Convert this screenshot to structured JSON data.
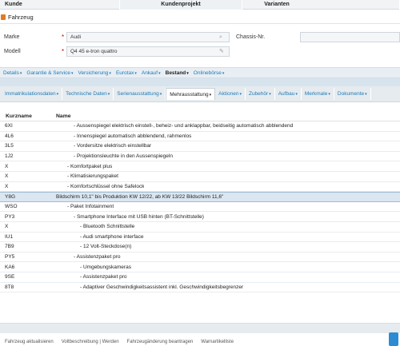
{
  "top_tabs": [
    "Kunde",
    "Kundenprojekt",
    "Varianten"
  ],
  "panel": {
    "title": "Fahrzeug"
  },
  "form": {
    "marke_label": "Marke",
    "marke_value": "Audi",
    "modell_label": "Modell",
    "modell_value": "Q4 45 e-tron quattro",
    "chassis_label": "Chassis-Nr.",
    "required_mark": "*"
  },
  "nav1": [
    {
      "label": "Details",
      "active": false
    },
    {
      "label": "Garantie & Service",
      "active": false
    },
    {
      "label": "Versicherung",
      "active": false
    },
    {
      "label": "Eurotax",
      "active": false
    },
    {
      "label": "Ankauf",
      "active": false
    },
    {
      "label": "Bestand",
      "active": true
    },
    {
      "label": "Onlinebörse",
      "active": false
    }
  ],
  "nav2": [
    {
      "label": "Immatrikulationsdaten",
      "active": false
    },
    {
      "label": "Technische Daten",
      "active": false
    },
    {
      "label": "Serienausstattung",
      "active": false
    },
    {
      "label": "Mehrausstattung",
      "active": true
    },
    {
      "label": "Aktionen",
      "active": false
    },
    {
      "label": "Zubehör",
      "active": false
    },
    {
      "label": "Aufbau",
      "active": false
    },
    {
      "label": "Merkmale",
      "active": false
    },
    {
      "label": "Dokumente",
      "active": false
    }
  ],
  "grid": {
    "headers": [
      "Kurzname",
      "Name"
    ],
    "rows": [
      {
        "code": "6XI",
        "name": "- Aussenspiegel elektrisch einstell-, beheiz- und anklappbar, beidseitig automatisch abblendend",
        "indent": 1,
        "selected": false
      },
      {
        "code": "4L6",
        "name": "- Innenspiegel automatisch abblendend, rahmenlos",
        "indent": 1,
        "selected": false
      },
      {
        "code": "3L5",
        "name": "- Vordersitze elektrisch einstellbar",
        "indent": 1,
        "selected": false
      },
      {
        "code": "1J2",
        "name": "- Projektionsleuchte in den Aussenspiegeln",
        "indent": 1,
        "selected": false
      },
      {
        "code": "X",
        "name": "- Komfortpaket plus",
        "indent": 0,
        "selected": false
      },
      {
        "code": "X",
        "name": "- Klimatisierungspaket",
        "indent": 0,
        "selected": false
      },
      {
        "code": "X",
        "name": "- Komfortschlüssel ohne Safelock",
        "indent": 0,
        "selected": false
      },
      {
        "code": "Y8G",
        "name": "Bildschirm 10,1\" bis Produktion KW 12/22, ab KW 13/22 Bildschirm 11,6\"",
        "indent": -1,
        "selected": true
      },
      {
        "code": "WSO",
        "name": "- Paket Infotainment",
        "indent": 0,
        "selected": false
      },
      {
        "code": "PY3",
        "name": "- Smartphone Interface mit USB hinten (BT-Schnittstelle)",
        "indent": 1,
        "selected": false
      },
      {
        "code": "X",
        "name": "- Bluetooth Schnittstelle",
        "indent": 2,
        "selected": false
      },
      {
        "code": "IU1",
        "name": "- Audi smartphone interface",
        "indent": 2,
        "selected": false
      },
      {
        "code": "7B9",
        "name": "- 12 Volt-Steckdose(n)",
        "indent": 2,
        "selected": false
      },
      {
        "code": "PY5",
        "name": "- Assistenzpaket pro",
        "indent": 1,
        "selected": false
      },
      {
        "code": "KA6",
        "name": "- Umgebungskameras",
        "indent": 2,
        "selected": false
      },
      {
        "code": "9SE",
        "name": "- Assistenzpaket pro",
        "indent": 2,
        "selected": false
      },
      {
        "code": "8T8",
        "name": "- Adaptiver Geschwindigkeitsassistent inkl. Geschwindigkeitsbegrenzer",
        "indent": 2,
        "selected": false
      }
    ]
  },
  "footer_actions": [
    "Fahrzeug aktualisieren",
    "Voltbeschreibung | Werden",
    "Fahrzeugänderung beantragen",
    "Warnartikelliste"
  ],
  "colors": {
    "link": "#1e7ab8",
    "selected_row": "#dae6f0",
    "accent": "#2d8bd1"
  }
}
